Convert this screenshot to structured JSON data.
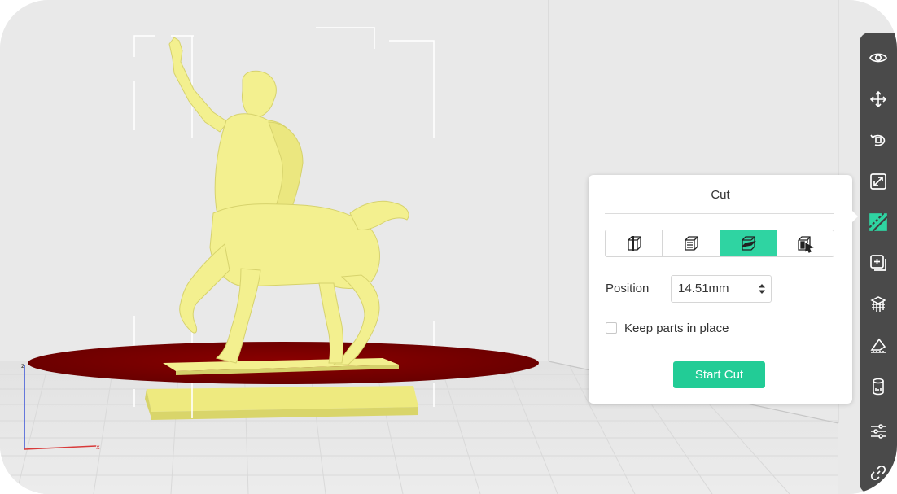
{
  "toolbar": {
    "items": [
      {
        "icon": "eye-icon",
        "label": "View"
      },
      {
        "icon": "move-icon",
        "label": "Move"
      },
      {
        "icon": "rotate-icon",
        "label": "Rotate"
      },
      {
        "icon": "scale-icon",
        "label": "Scale"
      },
      {
        "icon": "cut-icon",
        "label": "Cut",
        "active": true
      },
      {
        "icon": "duplicate-icon",
        "label": "Duplicate"
      },
      {
        "icon": "supports-icon",
        "label": "Supports"
      },
      {
        "icon": "measure-icon",
        "label": "Measure"
      },
      {
        "icon": "cylinder-icon",
        "label": "Hollow"
      },
      {
        "icon": "settings-sliders-icon",
        "label": "Settings"
      },
      {
        "icon": "link-icon",
        "label": "Link"
      }
    ],
    "accent_color": "#2fd4a2"
  },
  "cut_panel": {
    "title": "Cut",
    "modes": [
      {
        "icon": "cut-plane-vertical-icon",
        "selected": false
      },
      {
        "icon": "cut-plane-horizontal-icon",
        "selected": false
      },
      {
        "icon": "cut-plane-tilted-icon",
        "selected": true
      },
      {
        "icon": "cut-plane-pointer-icon",
        "selected": false
      }
    ],
    "position_label": "Position",
    "position_value": "14.51mm",
    "keep_parts_label": "Keep parts in place",
    "keep_parts_checked": false,
    "start_button": "Start Cut"
  },
  "viewport": {
    "axis_labels": {
      "z": "z",
      "x": "x"
    },
    "model_color": "#f3f08f",
    "cut_plane_color": "#7a0000",
    "background_color": "#e9e9e9"
  }
}
